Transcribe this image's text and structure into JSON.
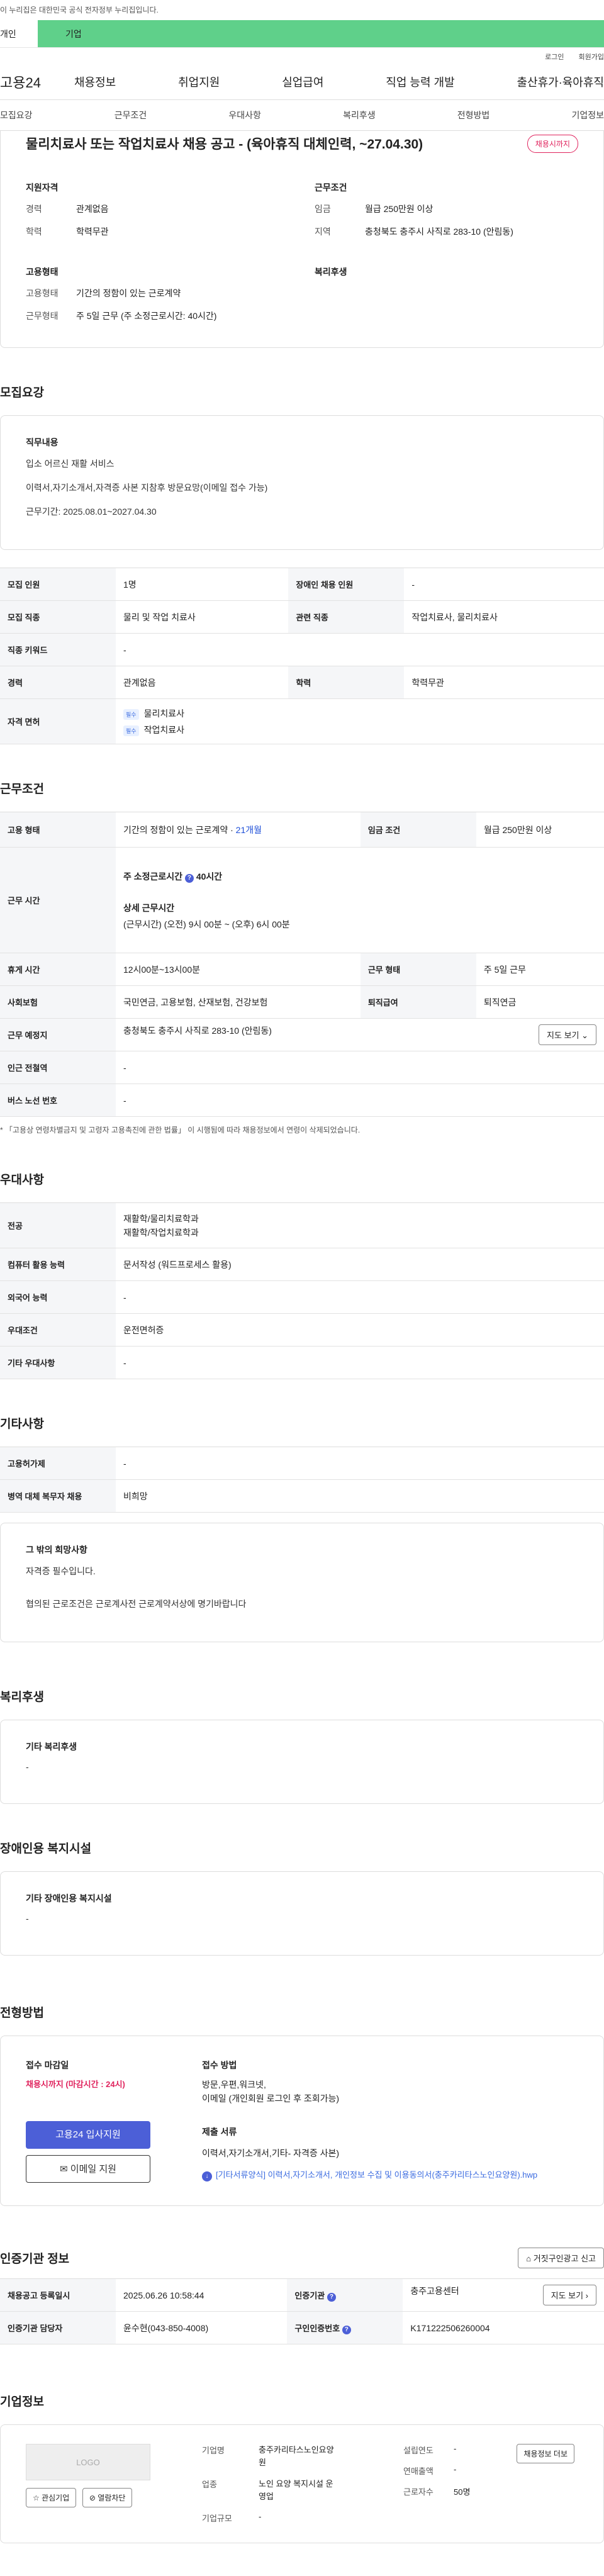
{
  "notice": "이 누리집은 대한민국 공식 전자정부 누리집입니다.",
  "type_tabs": [
    "개인",
    "기업"
  ],
  "util": [
    "로그인",
    "회원가입"
  ],
  "logo": "고용24",
  "gnb": [
    "채용정보",
    "취업지원",
    "실업급여",
    "직업 능력 개발",
    "출산휴가·육아휴직"
  ],
  "sub_tabs": [
    "모집요강",
    "근무조건",
    "우대사항",
    "복리후생",
    "전형방법",
    "기업정보"
  ],
  "header": {
    "title": "물리치료사 또는 작업치료사 채용 공고 - (육아휴직 대체인력, ~27.04.30)",
    "badge": "채용시까지",
    "qual_title": "지원자격",
    "qual": [
      [
        "경력",
        "관계없음"
      ],
      [
        "학력",
        "학력무관"
      ]
    ],
    "cond_title": "근무조건",
    "cond": [
      [
        "임금",
        "월급 250만원 이상"
      ],
      [
        "지역",
        "충청북도 충주시 사직로 283-10 (안림동)"
      ]
    ],
    "emp_title": "고용형태",
    "emp": [
      [
        "고용형태",
        "기간의 정함이 있는 근로계약"
      ],
      [
        "근무형태",
        "주 5일 근무 (주 소정근로시간: 40시간)"
      ]
    ],
    "welfare_title": "복리후생"
  },
  "recruit": {
    "title": "모집요강",
    "job_title": "직무내용",
    "job_lines": [
      "입소 어르신 재활 서비스",
      "이력서,자기소개서,자격증 사본 지참후 방문요망(이메일 접수 가능)",
      "근무기간: 2025.08.01~2027.04.30"
    ],
    "rows": [
      [
        "모집 인원",
        "1명",
        "장애인 채용 인원",
        "-"
      ],
      [
        "모집 직종",
        "물리 및 작업 치료사",
        "관련 직종",
        "작업치료사, 물리치료사"
      ],
      [
        "직종 키워드",
        "-"
      ],
      [
        "경력",
        "관계없음",
        "학력",
        "학력무관"
      ]
    ],
    "license_label": "자격 면허",
    "license_tag": "필수",
    "licenses": [
      "물리치료사",
      "작업치료사"
    ]
  },
  "work": {
    "title": "근무조건",
    "emp_label": "고용 형태",
    "emp_value": "기간의 정함이 있는 근로계약 · ",
    "emp_months": "21개월",
    "wage_label": "임금 조건",
    "wage_value": "월급 250만원 이상",
    "time_label": "근무 시간",
    "time_week": "주 소정근로시간",
    "time_week_val": "40시간",
    "time_detail_title": "상세 근무시간",
    "time_detail": "(근무시간) (오전) 9시 00분 ~ (오후) 6시 00분",
    "rest_label": "휴게 시간",
    "rest_value": "12시00분~13시00분",
    "form_label": "근무 형태",
    "form_value": "주 5일 근무",
    "ins_label": "사회보험",
    "ins_value": "국민연금, 고용보험, 산재보험, 건강보험",
    "retire_label": "퇴직급여",
    "retire_value": "퇴직연금",
    "place_label": "근무 예정지",
    "place_value": "충청북도 충주시 사직로 283-10 (안림동)",
    "map_btn": "지도 보기 ⌄",
    "subway_label": "인근 전철역",
    "subway_value": "-",
    "bus_label": "버스 노선 번호",
    "bus_value": "-",
    "note": "* 「고용상 연령차별금지 및 고령자 고용촉진에 관한 법률」 이 시행됨에 따라 채용정보에서 연령이 삭제되었습니다."
  },
  "pref": {
    "title": "우대사항",
    "rows": [
      [
        "전공",
        "재활학/물리치료학과\n재활학/작업치료학과"
      ],
      [
        "컴퓨터 활용 능력",
        "문서작성 (워드프로세스 활용)"
      ],
      [
        "외국어 능력",
        "-"
      ],
      [
        "우대조건",
        "운전면허증"
      ],
      [
        "기타 우대사항",
        "-"
      ]
    ]
  },
  "etc": {
    "title": "기타사항",
    "rows": [
      [
        "고용허가제",
        "-"
      ],
      [
        "병역 대체 복무자 채용",
        "비희망"
      ]
    ],
    "box_title": "그 밖의 희망사항",
    "box_lines": [
      "자격증 필수입니다.",
      "협의된 근로조건은 근로계사전 근로계약서상에 명기바랍니다"
    ]
  },
  "benefit": {
    "title": "복리후생",
    "box_title": "기타 복리후생",
    "box_value": "-"
  },
  "disabled": {
    "title": "장애인용 복지시설",
    "box_title": "기타 장애인용 복지시설",
    "box_value": "-"
  },
  "apply": {
    "title": "전형방법",
    "deadline_label": "접수 마감일",
    "deadline_value": "채용시까지 (마감시간 : 24시)",
    "btn_apply": "고용24 입사지원",
    "btn_email": "이메일 지원",
    "method_label": "접수 방법",
    "method_lines": [
      "방문,우편,워크넷,",
      "이메일 (개인회원 로그인 후 조회가능)"
    ],
    "docs_label": "제출 서류",
    "docs_value": "이력서,자기소개서,기타- 자격증 사본)",
    "file": "[기타서류양식] 이력서,자기소개서, 개인정보 수집 및 이용동의서(충주카리타스노인요양원).hwp"
  },
  "agency": {
    "title": "인증기관 정보",
    "report_btn": "거짓구인광고 신고",
    "rows": [
      [
        "채용공고 등록일시",
        "2025.06.26 10:58:44",
        "인증기관",
        "충주고용센터"
      ],
      [
        "인증기관 담당자",
        "윤수현(043-850-4008)",
        "구인인증번호",
        "K171222506260004"
      ]
    ],
    "map_btn": "지도 보기 ›"
  },
  "company": {
    "title": "기업정보",
    "logo": "LOGO",
    "btn_fav": "☆ 관심기업",
    "btn_block": "⊘ 열람차단",
    "name_label": "기업명",
    "name_value": "충주카리타스노인요양원",
    "industry_label": "업종",
    "industry_value": "노인 요양 복지시설 운영업",
    "size_label": "기업규모",
    "size_value": "-",
    "founded_label": "설립연도",
    "founded_value": "-",
    "sales_label": "연매출액",
    "sales_value": "-",
    "staff_label": "근로자수",
    "staff_value": "50명",
    "more_btn": "채용정보 더보"
  }
}
